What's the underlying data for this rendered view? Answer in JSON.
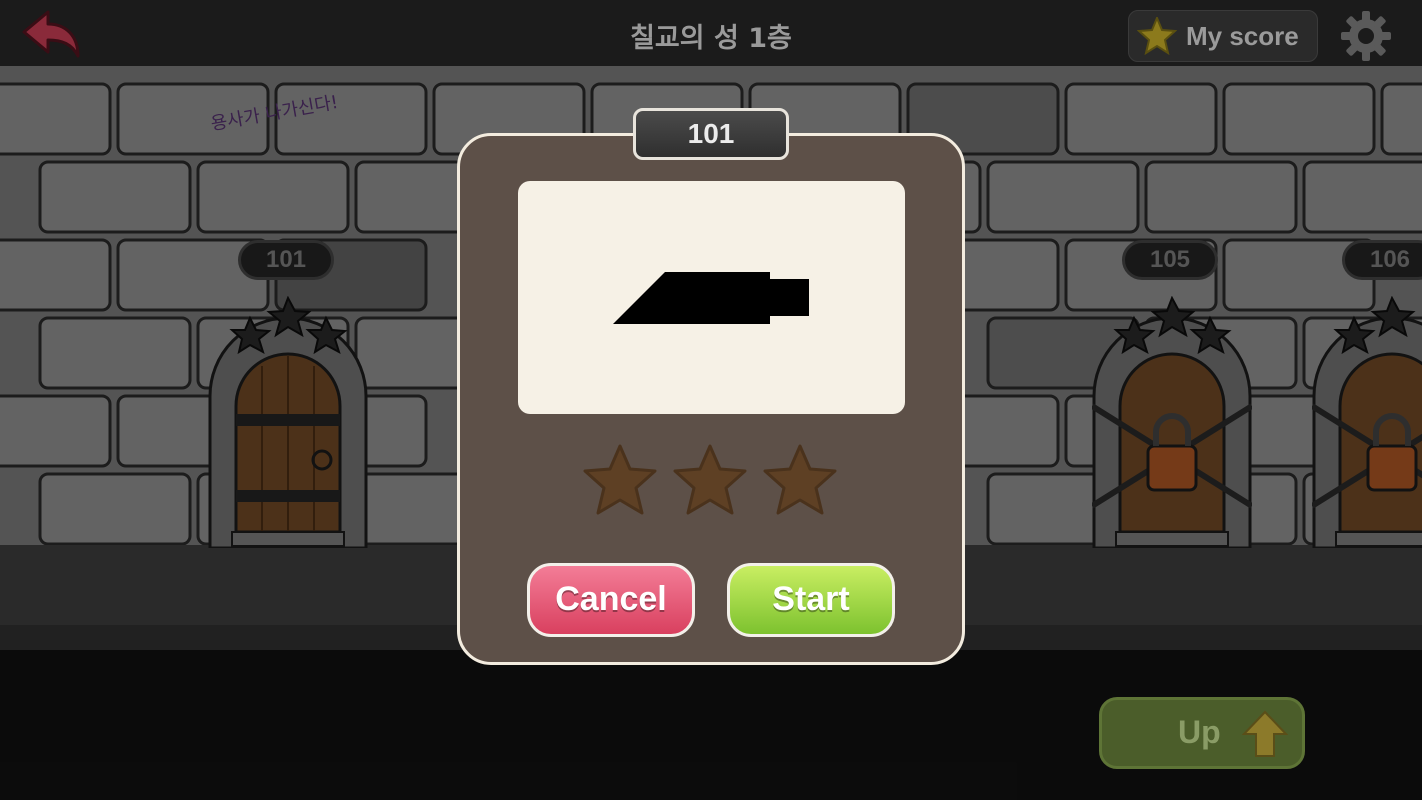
{
  "header": {
    "title": "칠교의 성 1층",
    "score_label": "My score"
  },
  "rooms": [
    {
      "number": "101",
      "locked": false
    },
    {
      "number": "105",
      "locked": true
    },
    {
      "number": "106",
      "locked": true
    }
  ],
  "wall_graffiti": "용사가 나가신다!",
  "level_modal": {
    "level_number": "101",
    "stars_earned": 0,
    "stars_total": 3,
    "cancel_label": "Cancel",
    "start_label": "Start"
  },
  "footer": {
    "up_label": "Up"
  },
  "colors": {
    "cancel": "#e25672",
    "start": "#a3d94a",
    "modal_bg": "#5d5048",
    "preview_bg": "#f6f1e6",
    "star_empty": "#5e4024"
  }
}
